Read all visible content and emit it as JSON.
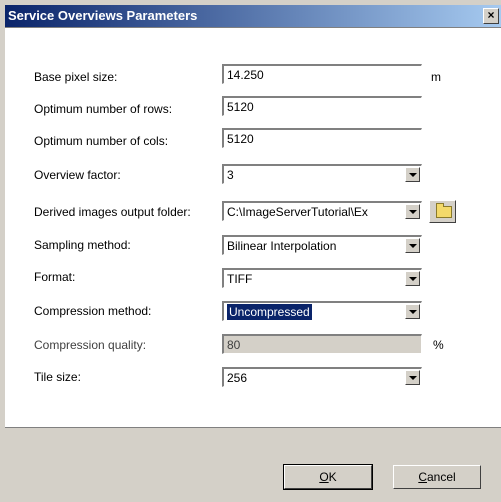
{
  "window": {
    "title": "Service Overviews Parameters",
    "close_label": "×"
  },
  "fields": {
    "base_pixel_size": {
      "label": "Base pixel size:",
      "value": "14.250",
      "unit": "m"
    },
    "optimum_rows": {
      "label": "Optimum number of rows:",
      "value": "5120"
    },
    "optimum_cols": {
      "label": "Optimum number of cols:",
      "value": "5120"
    },
    "overview_factor": {
      "label": "Overview factor:",
      "value": "3"
    },
    "derived_folder": {
      "label": "Derived images output folder:",
      "value": "C:\\ImageServerTutorial\\Ex"
    },
    "sampling_method": {
      "label": "Sampling method:",
      "value": "Bilinear Interpolation"
    },
    "format": {
      "label": "Format:",
      "value": "TIFF"
    },
    "compression_method": {
      "label": "Compression method:",
      "value": "Uncompressed"
    },
    "compression_quality": {
      "label": "Compression quality:",
      "value": "80",
      "unit": "%"
    },
    "tile_size": {
      "label": "Tile size:",
      "value": "256"
    }
  },
  "buttons": {
    "ok_accel": "O",
    "ok_rest": "K",
    "cancel_accel": "C",
    "cancel_rest": "ancel"
  },
  "icons": {
    "folder": "folder-icon",
    "dropdown": "chevron-down-icon"
  },
  "colors": {
    "title_start": "#0a246a",
    "title_end": "#a6caf0",
    "selection": "#0a246a"
  }
}
